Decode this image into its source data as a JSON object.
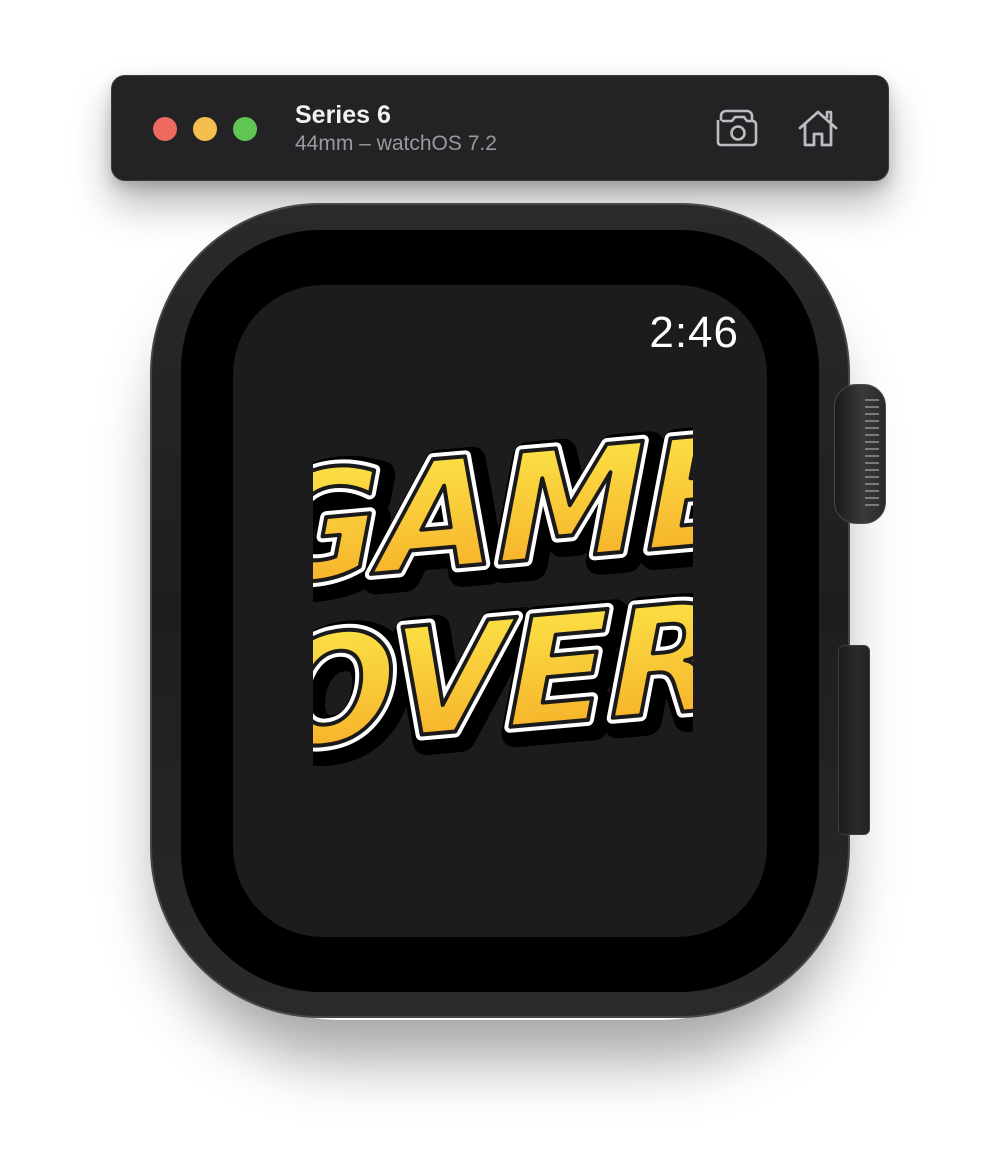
{
  "simulator": {
    "device_name": "Series 6",
    "device_subtitle": "44mm – watchOS 7.2",
    "traffic_lights": {
      "close_color": "#ec6a5e",
      "minimize_color": "#f4bf4f",
      "maximize_color": "#61c554"
    },
    "toolbar_icons": [
      "camera-icon",
      "home-icon"
    ]
  },
  "watch": {
    "time": "2:46",
    "screen": {
      "graphic": "game-over-graphic",
      "graphic_text_lines": [
        "GAME",
        "OVER"
      ],
      "graphic_colors": {
        "fill_top": "#fbe94a",
        "fill_bottom": "#f6a825",
        "outline": "#ffffff",
        "shadow": "#000000"
      }
    }
  }
}
